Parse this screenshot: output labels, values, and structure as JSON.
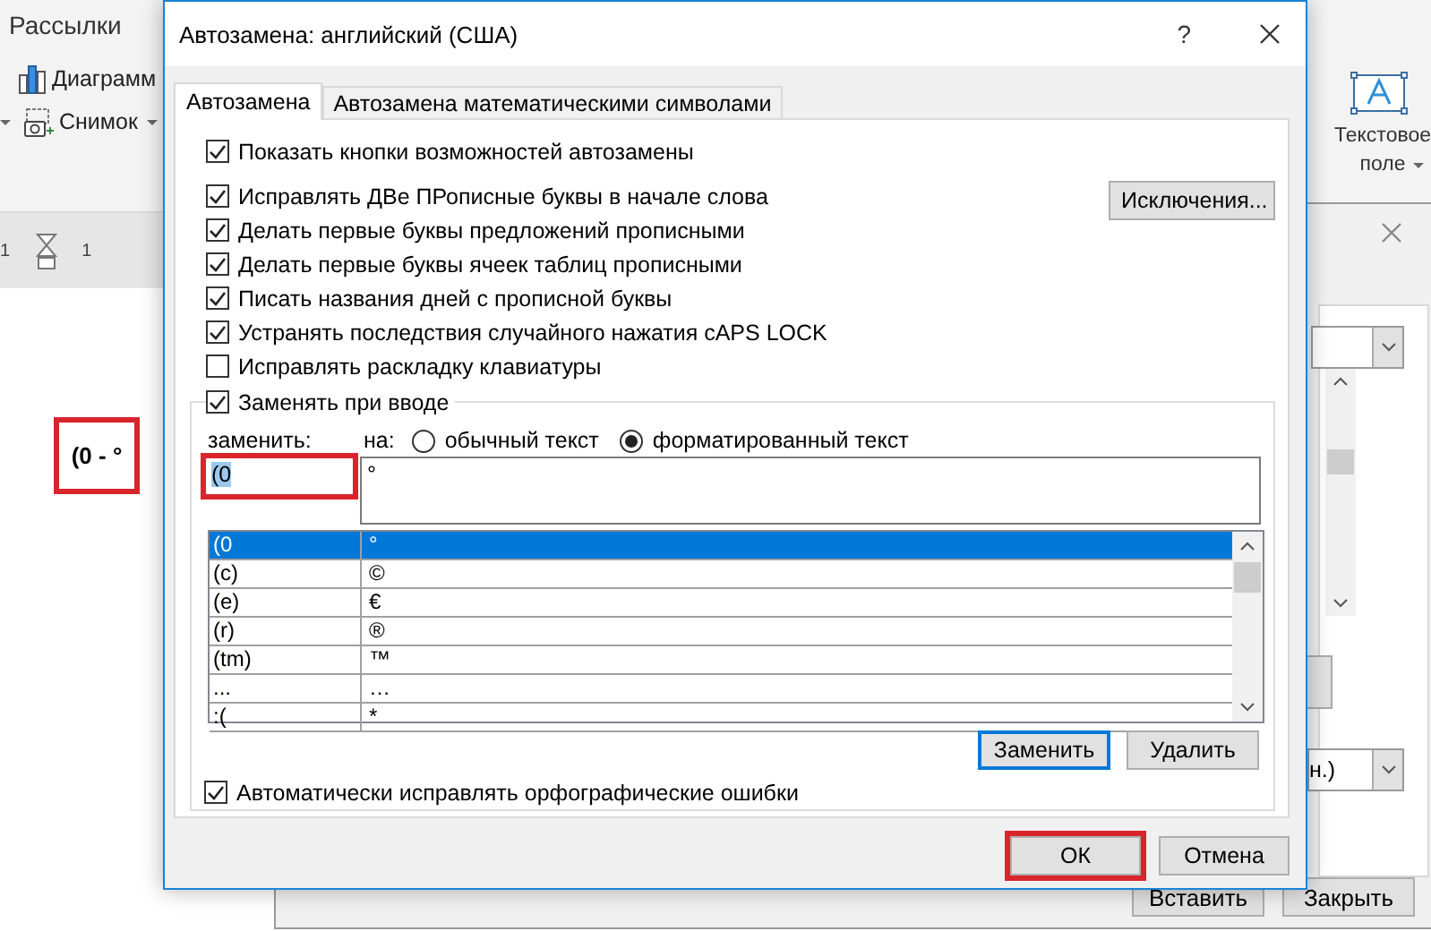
{
  "word": {
    "tab": "Рассылки",
    "ribbon_items": [
      {
        "label": "Диаграмм",
        "kind": "chart",
        "dropdown": false
      },
      {
        "label": "Снимок",
        "kind": "camera",
        "dropdown": true
      }
    ],
    "text_box_button": {
      "label": "Текстовое поле",
      "dropdown": true
    },
    "ruler_numbers": [
      "1",
      "1"
    ],
    "document_text": "(0 - °"
  },
  "back_dialog": {
    "dropdown_text": "н.)",
    "buttons": [
      "Вставить",
      "Закрыть"
    ]
  },
  "dialog": {
    "title": "Автозамена: английский (США)",
    "help": "?",
    "tabs": [
      {
        "label": "Автозамена",
        "selected": true
      },
      {
        "label": "Автозамена математическими символами",
        "selected": false
      }
    ],
    "show_buttons": {
      "label": "Показать кнопки возможностей автозамены",
      "checked": true
    },
    "options": [
      {
        "label": "Исправлять ДВе ПРописные буквы в начале слова",
        "checked": true
      },
      {
        "label": "Делать первые буквы предложений прописными",
        "checked": true
      },
      {
        "label": "Делать первые буквы ячеек таблиц прописными",
        "checked": true
      },
      {
        "label": "Писать названия дней с прописной буквы",
        "checked": true
      },
      {
        "label": "Устранять последствия случайного нажатия cAPS LOCK",
        "checked": true
      },
      {
        "label": "Исправлять раскладку клавиатуры",
        "checked": false
      }
    ],
    "exceptions_button": "Исключения...",
    "replace_as_you_type": {
      "label": "Заменять при вводе",
      "checked": true
    },
    "replace_label": "заменить:",
    "with_label": "на:",
    "radios": [
      {
        "label": "обычный текст",
        "selected": false
      },
      {
        "label": "форматированный текст",
        "selected": true
      }
    ],
    "replace_value": "(0",
    "with_value": "°",
    "replace_highlighted": true,
    "entries": [
      {
        "key": "(0",
        "value": "°",
        "selected": true
      },
      {
        "key": "(c)",
        "value": "©",
        "selected": false
      },
      {
        "key": "(e)",
        "value": "€",
        "selected": false
      },
      {
        "key": "(r)",
        "value": "®",
        "selected": false
      },
      {
        "key": "(tm)",
        "value": "™",
        "selected": false
      },
      {
        "key": "...",
        "value": "…",
        "selected": false
      },
      {
        "key": ":(",
        "value": "*",
        "selected": false
      }
    ],
    "entry_buttons": [
      {
        "label": "Заменить",
        "default": true
      },
      {
        "label": "Удалить",
        "default": false
      }
    ],
    "autocorrect_spelling": {
      "label": "Автоматически исправлять орфографические ошибки",
      "checked": true
    },
    "footer_buttons": [
      {
        "label": "ОК",
        "highlighted": true
      },
      {
        "label": "Отмена",
        "highlighted": false
      }
    ]
  }
}
